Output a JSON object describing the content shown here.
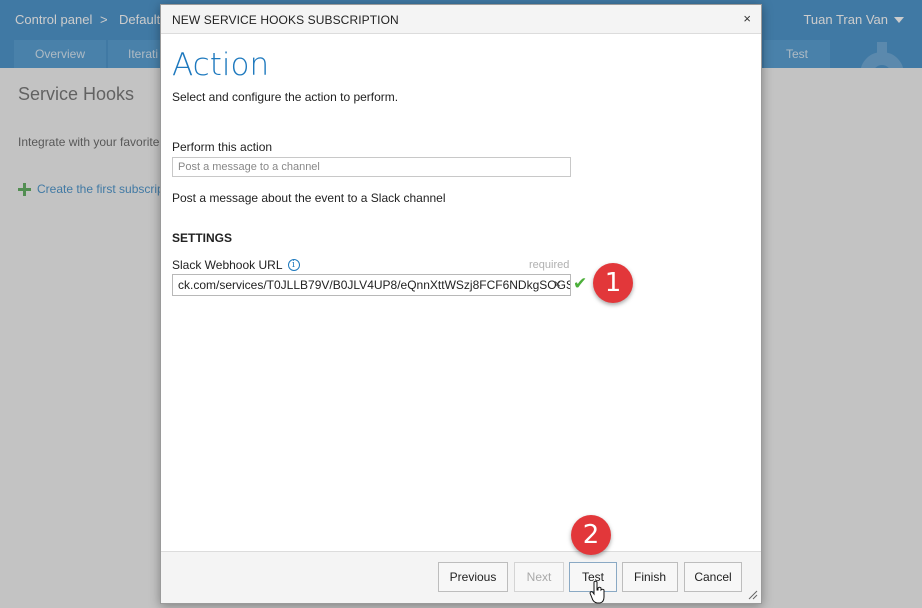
{
  "page": {
    "breadcrumb_root": "Control panel",
    "breadcrumb_sep": ">",
    "breadcrumb_current": "Default",
    "user_name": "Tuan Tran Van",
    "tabs": [
      "Overview",
      "Iterati",
      "Test"
    ],
    "section_title": "Service Hooks",
    "intro_text": "Integrate with your favorite",
    "create_link": "Create the first subscrip"
  },
  "dialog": {
    "title": "NEW SERVICE HOOKS SUBSCRIPTION",
    "close_glyph": "×",
    "heading": "Action",
    "subheading": "Select and configure the action to perform.",
    "perform_label": "Perform this action",
    "perform_placeholder": "Post a message to a channel",
    "perform_description": "Post a message about the event to a Slack channel",
    "settings_heading": "SETTINGS",
    "webhook_label": "Slack Webhook URL",
    "webhook_required": "required",
    "webhook_value": "ck.com/services/T0JLLB79V/B0JLV4UP8/eQnnXttWSzj8FCF6NDkgSOGS",
    "clear_glyph": "×",
    "valid_glyph": "✔"
  },
  "footer": {
    "previous": "Previous",
    "next": "Next",
    "test": "Test",
    "finish": "Finish",
    "cancel": "Cancel"
  },
  "annotations": {
    "step1": "1",
    "step2": "2"
  },
  "colors": {
    "brand": "#1e79be",
    "badge": "#e2373a",
    "valid": "#4caf3a"
  }
}
